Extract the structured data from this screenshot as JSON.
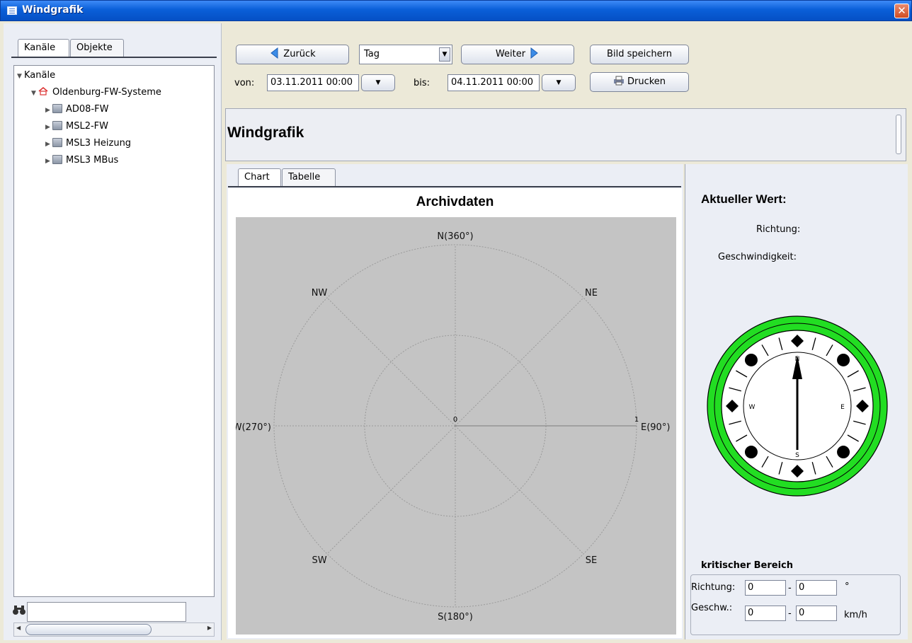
{
  "window": {
    "title": "Windgrafik",
    "close": "✕"
  },
  "left": {
    "tabs": [
      "Kanäle",
      "Objekte"
    ],
    "tree": {
      "root": "Kanäle",
      "group": "Oldenburg-FW-Systeme",
      "items": [
        "AD08-FW",
        "MSL2-FW",
        "MSL3 Heizung",
        "MSL3 MBus"
      ]
    },
    "search_value": ""
  },
  "toolbar": {
    "back_label": "Zurück",
    "period_value": "Tag",
    "next_label": "Weiter",
    "save_label": "Bild speichern",
    "print_label": "Drucken",
    "from_label": "von:",
    "from_value": "03.11.2011 00:00",
    "to_label": "bis:",
    "to_value": "04.11.2011 00:00"
  },
  "header": {
    "title": "Windgrafik"
  },
  "chart_tabs": [
    "Chart",
    "Tabelle"
  ],
  "chart_data": {
    "type": "polar",
    "title": "Archivdaten",
    "directions": [
      "N(360°)",
      "NE",
      "E(90°)",
      "SE",
      "S(180°)",
      "SW",
      "W(270°)",
      "NW"
    ],
    "radial_ticks": [
      "0",
      "1"
    ],
    "series": [],
    "colors": {
      "plot_bg": "#c4c4c4",
      "grid": "#9a9a9a"
    }
  },
  "side": {
    "current_title": "Aktueller Wert:",
    "direction_label": "Richtung:",
    "speed_label": "Geschwindigkeit:",
    "compass": {
      "n": "N",
      "e": "E",
      "s": "S",
      "w": "W",
      "ring_color": "#22dd22"
    },
    "critical_title": "kritischer Bereich",
    "crit_dir_label": "Richtung:",
    "crit_dir_from": "0",
    "crit_dir_to": "0",
    "crit_dir_unit": "°",
    "crit_speed_label": "Geschw.:",
    "crit_speed_from": "0",
    "crit_speed_to": "0",
    "crit_speed_unit": "km/h",
    "dash": "-"
  }
}
